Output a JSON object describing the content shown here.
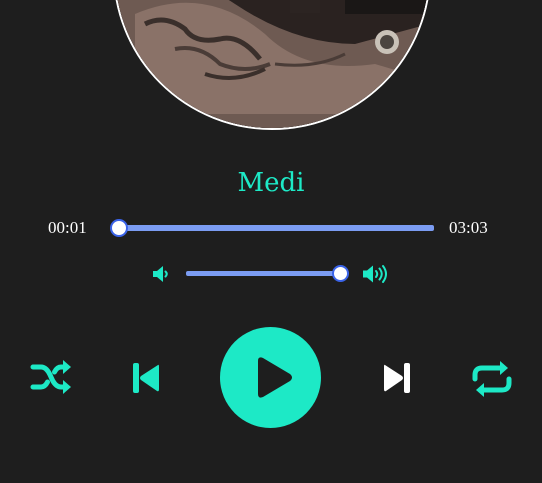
{
  "track": {
    "title": "Medi"
  },
  "progress": {
    "current_time": "00:01",
    "total_time": "03:03",
    "fraction": 0.005
  },
  "volume": {
    "level": 0.95
  },
  "controls": {
    "shuffle_icon": "shuffle-icon",
    "previous_icon": "skip-previous-icon",
    "play_icon": "play-icon",
    "next_icon": "skip-next-icon",
    "repeat_icon": "repeat-icon",
    "volume_low_icon": "volume-low-icon",
    "volume_high_icon": "volume-high-icon"
  },
  "colors": {
    "accent": "#1de9c6",
    "background": "#1e1e1e",
    "slider_track": "#7b9cf2",
    "slider_thumb_border": "#3a63e8",
    "next_button": "#ffffff"
  }
}
